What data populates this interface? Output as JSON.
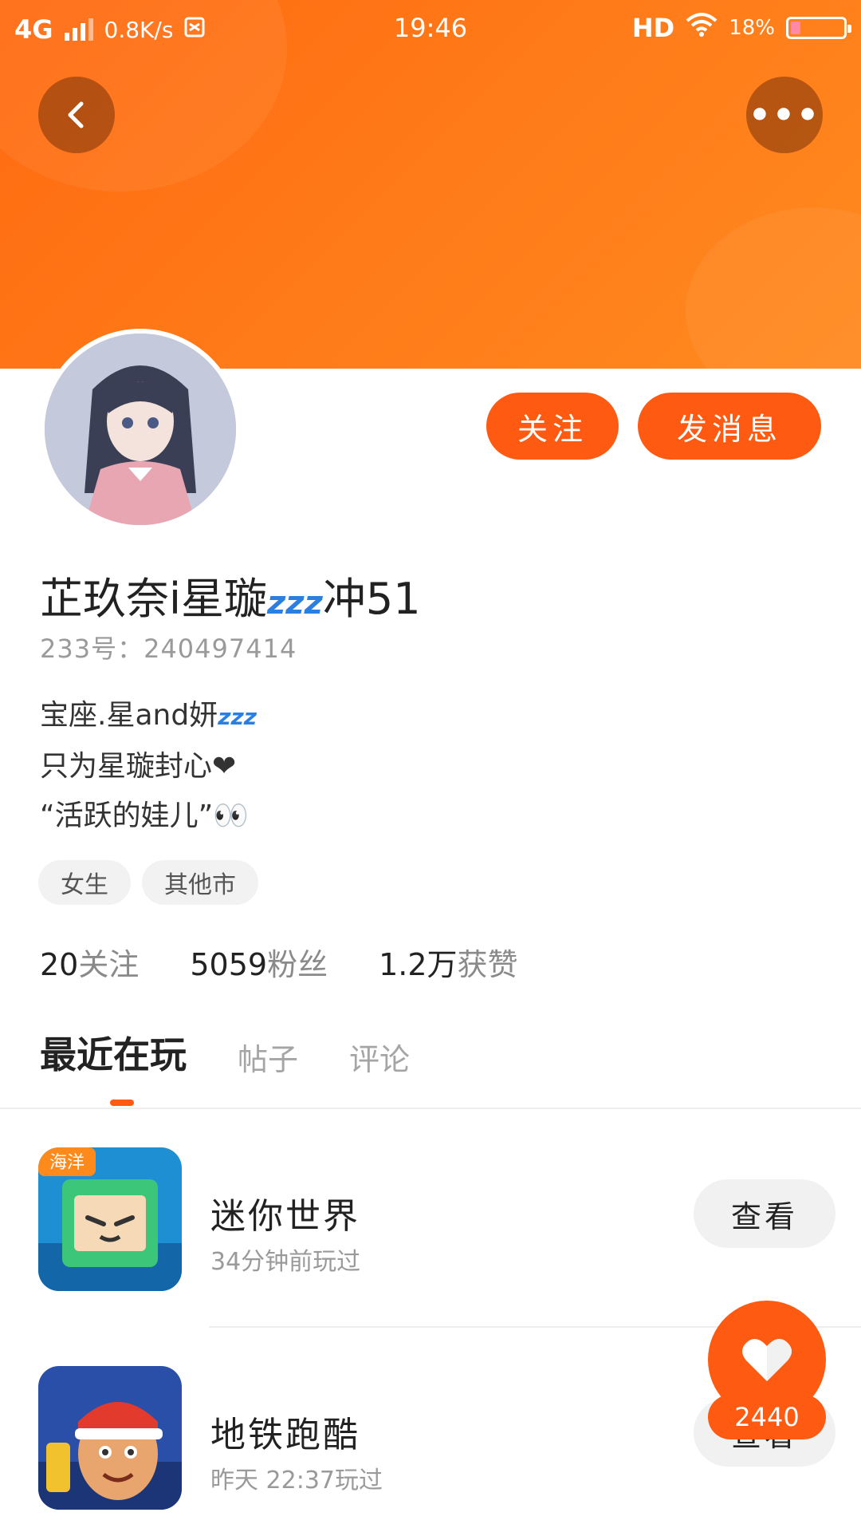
{
  "status_bar": {
    "network": "4G",
    "speed": "0.8K/s",
    "time": "19:46",
    "hd": "HD",
    "battery": "18%",
    "battery_level": 0.18
  },
  "header": {
    "back_icon": "chevron-left-icon",
    "more_icon": "more-dots-icon",
    "more_label": "•••"
  },
  "profile": {
    "follow_label": "关注",
    "message_label": "发消息",
    "name": "芷玖奈i星璇",
    "name_suffix": "冲51",
    "name_emoji": "zzz",
    "uid": "233号：240497414",
    "bio": {
      "line1": "宝座.星and妍",
      "line1_emoji": "zzz",
      "line2": "只为星璇封心❤",
      "line3": "“活跃的娃儿”👀"
    },
    "tags": [
      "女生",
      "其他市"
    ],
    "stats": [
      {
        "num": "20",
        "label": "关注"
      },
      {
        "num": "5059",
        "label": "粉丝"
      },
      {
        "num": "1.2万",
        "label": "获赞"
      }
    ]
  },
  "tabs": [
    {
      "label": "最近在玩"
    },
    {
      "label": "帖子"
    },
    {
      "label": "评论"
    }
  ],
  "games": [
    {
      "title": "迷你世界",
      "time": "34分钟前玩过",
      "action": "查看",
      "badge": "海洋"
    },
    {
      "title": "地铁跑酷",
      "time": "昨天 22:37玩过",
      "action": "查看"
    }
  ],
  "like": {
    "count": "2440",
    "icon": "heart-icon"
  },
  "colors": {
    "accent": "#ff5a12",
    "header": "#ff7a18"
  }
}
